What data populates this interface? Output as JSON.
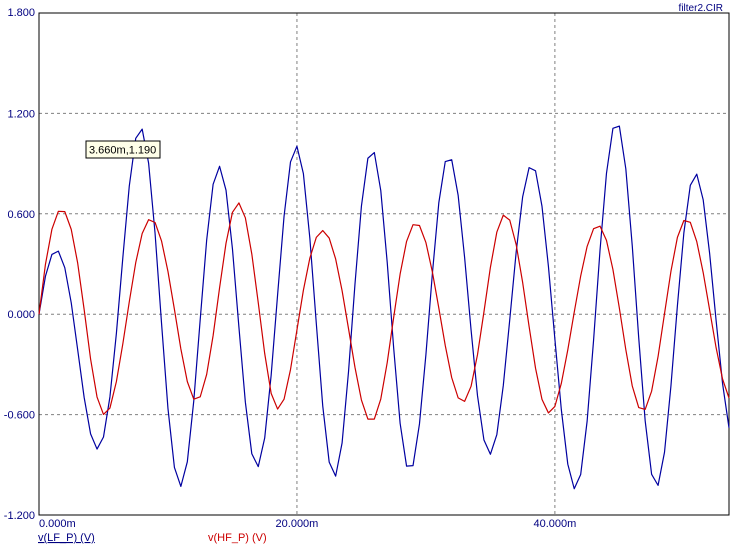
{
  "file_label": "filter2.CIR",
  "tooltip": "3.660m,1.190",
  "chart_data": {
    "type": "line",
    "title": "",
    "xlabel": "",
    "ylabel": "",
    "xlim": [
      0,
      0.0535
    ],
    "ylim": [
      -1.2,
      1.8
    ],
    "grid": true,
    "y_ticks": [
      "1.800",
      "1.200",
      "0.600",
      "0.000",
      "-0.600",
      "-1.200"
    ],
    "y_tick_values": [
      1.8,
      1.2,
      0.6,
      0.0,
      -0.6,
      -1.2
    ],
    "x_ticks": [
      "0.000m",
      "20.000m",
      "40.000m"
    ],
    "x_tick_values": [
      0,
      0.02,
      0.04
    ],
    "series": [
      {
        "name": "v(LF_P) (V)",
        "color": "#0000a0",
        "x": [
          0.0,
          0.0005,
          0.001,
          0.0015,
          0.002,
          0.0025,
          0.003,
          0.0035,
          0.004,
          0.0045,
          0.005,
          0.0055,
          0.006,
          0.0065,
          0.007,
          0.0075,
          0.008,
          0.0085,
          0.009,
          0.0095,
          0.01,
          0.0105,
          0.011,
          0.0115,
          0.012,
          0.0125,
          0.013,
          0.0135,
          0.014,
          0.0145,
          0.015,
          0.0155,
          0.016,
          0.0165,
          0.017,
          0.0175,
          0.018,
          0.0185,
          0.019,
          0.0195,
          0.02,
          0.0205,
          0.021,
          0.0215,
          0.022,
          0.0225,
          0.023,
          0.0235,
          0.024,
          0.0245,
          0.025,
          0.0255,
          0.026,
          0.0265,
          0.027,
          0.0275,
          0.028,
          0.0285,
          0.029,
          0.0295,
          0.03,
          0.0305,
          0.031,
          0.0315,
          0.032,
          0.0325,
          0.033,
          0.0335,
          0.034,
          0.0345,
          0.035,
          0.0355,
          0.036,
          0.0365,
          0.037,
          0.0375,
          0.038,
          0.0385,
          0.039,
          0.0395,
          0.04,
          0.0405,
          0.041,
          0.0415,
          0.042,
          0.0425,
          0.043,
          0.0435,
          0.044,
          0.0445,
          0.045,
          0.0455,
          0.046,
          0.0465,
          0.047,
          0.0475,
          0.048,
          0.0485,
          0.049,
          0.0495,
          0.05,
          0.0505,
          0.051,
          0.0515,
          0.052,
          0.0525,
          0.053,
          0.0535
        ],
        "values": [
          0.0,
          0.227,
          0.357,
          0.377,
          0.278,
          0.068,
          -0.213,
          -0.497,
          -0.715,
          -0.806,
          -0.734,
          -0.494,
          -0.115,
          0.338,
          0.766,
          1.051,
          1.106,
          0.902,
          0.483,
          -0.053,
          -0.564,
          -0.916,
          -1.029,
          -0.882,
          -0.518,
          -0.032,
          0.442,
          0.776,
          0.884,
          0.741,
          0.39,
          -0.077,
          -0.526,
          -0.834,
          -0.911,
          -0.74,
          -0.365,
          0.116,
          0.585,
          0.91,
          1.004,
          0.84,
          0.455,
          -0.054,
          -0.548,
          -0.884,
          -0.968,
          -0.77,
          -0.343,
          0.18,
          0.646,
          0.932,
          0.966,
          0.739,
          0.309,
          -0.202,
          -0.652,
          -0.908,
          -0.905,
          -0.656,
          -0.241,
          0.241,
          0.666,
          0.912,
          0.923,
          0.71,
          0.339,
          -0.093,
          -0.487,
          -0.752,
          -0.837,
          -0.719,
          -0.426,
          -0.033,
          0.373,
          0.701,
          0.876,
          0.857,
          0.645,
          0.285,
          -0.149,
          -0.571,
          -0.896,
          -1.043,
          -0.958,
          -0.639,
          -0.155,
          0.383,
          0.842,
          1.111,
          1.124,
          0.869,
          0.408,
          -0.141,
          -0.637,
          -0.957,
          -1.023,
          -0.825,
          -0.427,
          0.051,
          0.486,
          0.77,
          0.837,
          0.683,
          0.362,
          -0.037,
          -0.414,
          -0.679
        ]
      },
      {
        "name": "v(HF_P) (V)",
        "color": "#cc0000",
        "x": [
          0.0,
          0.0005,
          0.001,
          0.0015,
          0.002,
          0.0025,
          0.003,
          0.0035,
          0.004,
          0.0045,
          0.005,
          0.0055,
          0.006,
          0.0065,
          0.007,
          0.0075,
          0.008,
          0.0085,
          0.009,
          0.0095,
          0.01,
          0.0105,
          0.011,
          0.0115,
          0.012,
          0.0125,
          0.013,
          0.0135,
          0.014,
          0.0145,
          0.015,
          0.0155,
          0.016,
          0.0165,
          0.017,
          0.0175,
          0.018,
          0.0185,
          0.019,
          0.0195,
          0.02,
          0.0205,
          0.021,
          0.0215,
          0.022,
          0.0225,
          0.023,
          0.0235,
          0.024,
          0.0245,
          0.025,
          0.0255,
          0.026,
          0.0265,
          0.027,
          0.0275,
          0.028,
          0.0285,
          0.029,
          0.0295,
          0.03,
          0.0305,
          0.031,
          0.0315,
          0.032,
          0.0325,
          0.033,
          0.0335,
          0.034,
          0.0345,
          0.035,
          0.0355,
          0.036,
          0.0365,
          0.037,
          0.0375,
          0.038,
          0.0385,
          0.039,
          0.0395,
          0.04,
          0.0405,
          0.041,
          0.0415,
          0.042,
          0.0425,
          0.043,
          0.0435,
          0.044,
          0.0445,
          0.045,
          0.0455,
          0.046,
          0.0465,
          0.047,
          0.0475,
          0.048,
          0.0485,
          0.049,
          0.0495,
          0.05,
          0.0505,
          0.051,
          0.0515,
          0.052,
          0.0525,
          0.053,
          0.0535
        ],
        "values": [
          0.0,
          0.298,
          0.507,
          0.615,
          0.613,
          0.507,
          0.305,
          0.028,
          -0.268,
          -0.495,
          -0.599,
          -0.561,
          -0.403,
          -0.177,
          0.074,
          0.308,
          0.482,
          0.565,
          0.548,
          0.438,
          0.255,
          0.029,
          -0.208,
          -0.403,
          -0.508,
          -0.494,
          -0.36,
          -0.128,
          0.157,
          0.424,
          0.609,
          0.665,
          0.576,
          0.36,
          0.069,
          -0.235,
          -0.473,
          -0.567,
          -0.508,
          -0.331,
          -0.094,
          0.143,
          0.335,
          0.459,
          0.5,
          0.455,
          0.33,
          0.141,
          -0.087,
          -0.318,
          -0.513,
          -0.627,
          -0.627,
          -0.507,
          -0.289,
          -0.019,
          0.24,
          0.435,
          0.535,
          0.53,
          0.428,
          0.253,
          0.037,
          -0.187,
          -0.379,
          -0.5,
          -0.521,
          -0.431,
          -0.242,
          0.014,
          0.28,
          0.491,
          0.592,
          0.562,
          0.415,
          0.19,
          -0.073,
          -0.323,
          -0.509,
          -0.59,
          -0.551,
          -0.413,
          -0.213,
          0.012,
          0.228,
          0.405,
          0.511,
          0.526,
          0.441,
          0.267,
          0.036,
          -0.212,
          -0.429,
          -0.558,
          -0.569,
          -0.46,
          -0.253,
          0.003,
          0.257,
          0.459,
          0.56,
          0.549,
          0.434,
          0.248,
          0.025,
          -0.2,
          -0.387,
          -0.501
        ]
      }
    ]
  }
}
